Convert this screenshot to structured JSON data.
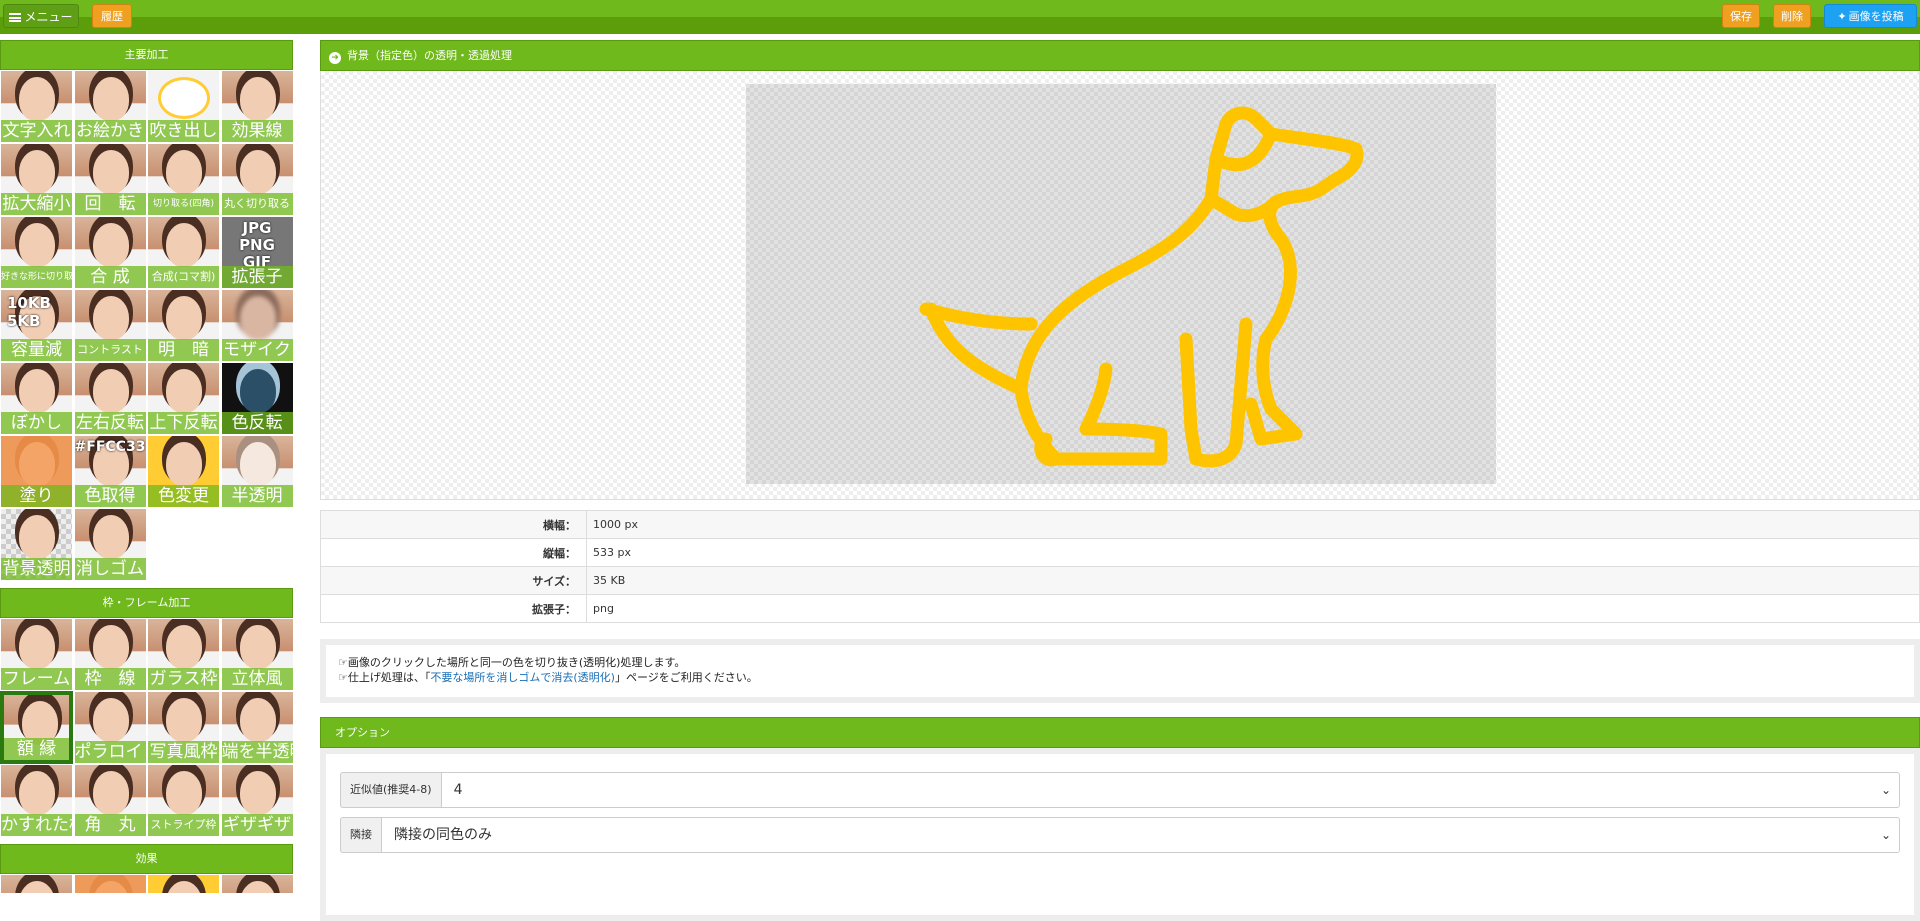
{
  "topbar": {
    "menu_label": "メニュー",
    "history_label": "履歴",
    "save_label": "保存",
    "delete_label": "削除",
    "tweet_label": "画像を投稿"
  },
  "sidebar": {
    "main_title": "主要加工",
    "main_tools": [
      "文字入れ",
      "お絵かき",
      "吹き出し",
      "効果線",
      "拡大縮小",
      "回　転",
      "切り取る(四角)",
      "丸く切り取る",
      "好きな形に切り取る",
      "合 成",
      "合成(コマ割)",
      "拡張子",
      "容量減",
      "コントラスト",
      "明　暗",
      "モザイク",
      "ぼかし",
      "左右反転",
      "上下反転",
      "色反転",
      "塗り",
      "色取得",
      "色変更",
      "半透明",
      "背景透明",
      "消しゴム"
    ],
    "overlays": {
      "ext": "JPG\nPNG\nGIF",
      "size": "10KB\n5KB",
      "color": "#FFCC33"
    },
    "frame_title": "枠・フレーム加工",
    "frame_tools": [
      "フレーム",
      "枠　線",
      "ガラス枠",
      "立体風",
      "額 縁",
      "ポラロイド",
      "写真風枠",
      "端を半透明",
      "かすれた枠",
      "角　丸",
      "ストライプ枠",
      "ギザギザ"
    ],
    "effect_title": "効果"
  },
  "main": {
    "title": "背景（指定色）の透明・透過処理",
    "dog_color": "#ffc400",
    "info": [
      {
        "key": "横幅：",
        "value": "1000 px"
      },
      {
        "key": "縦幅：",
        "value": "533 px"
      },
      {
        "key": "サイズ：",
        "value": "35 KB"
      },
      {
        "key": "拡張子：",
        "value": "png"
      }
    ],
    "note1": "画像のクリックした場所と同一の色を切り抜き(透明化)処理します。",
    "note2_pre": "仕上げ処理は、「",
    "note2_link": "不要な場所を消しゴムで消去(透明化)",
    "note2_post": "」ページをご利用ください。",
    "options_title": "オプション",
    "opt1_label": "近似値(推奨4-8)",
    "opt1_value": "4",
    "opt2_label": "隣接",
    "opt2_value": "隣接の同色のみ"
  }
}
